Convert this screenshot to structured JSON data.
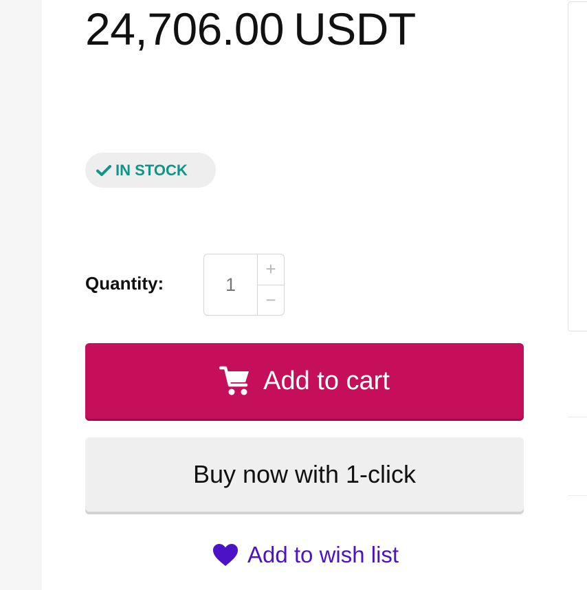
{
  "product": {
    "price_amount": "24,706.00",
    "price_currency": "USDT",
    "stock_status": "IN STOCK"
  },
  "quantity": {
    "label": "Quantity:",
    "value": "1",
    "increment_symbol": "+",
    "decrement_symbol": "−"
  },
  "actions": {
    "add_to_cart_label": "Add to cart",
    "buy_now_label": "Buy now with 1-click",
    "wish_list_label": "Add to wish list"
  },
  "icons": {
    "stock": "check-icon",
    "cart": "cart-icon",
    "wish": "heart-icon"
  },
  "colors": {
    "primary_button": "#c50f5a",
    "secondary_button": "#efefef",
    "stock_text": "#0f9488",
    "wish_link": "#4c12c6"
  }
}
